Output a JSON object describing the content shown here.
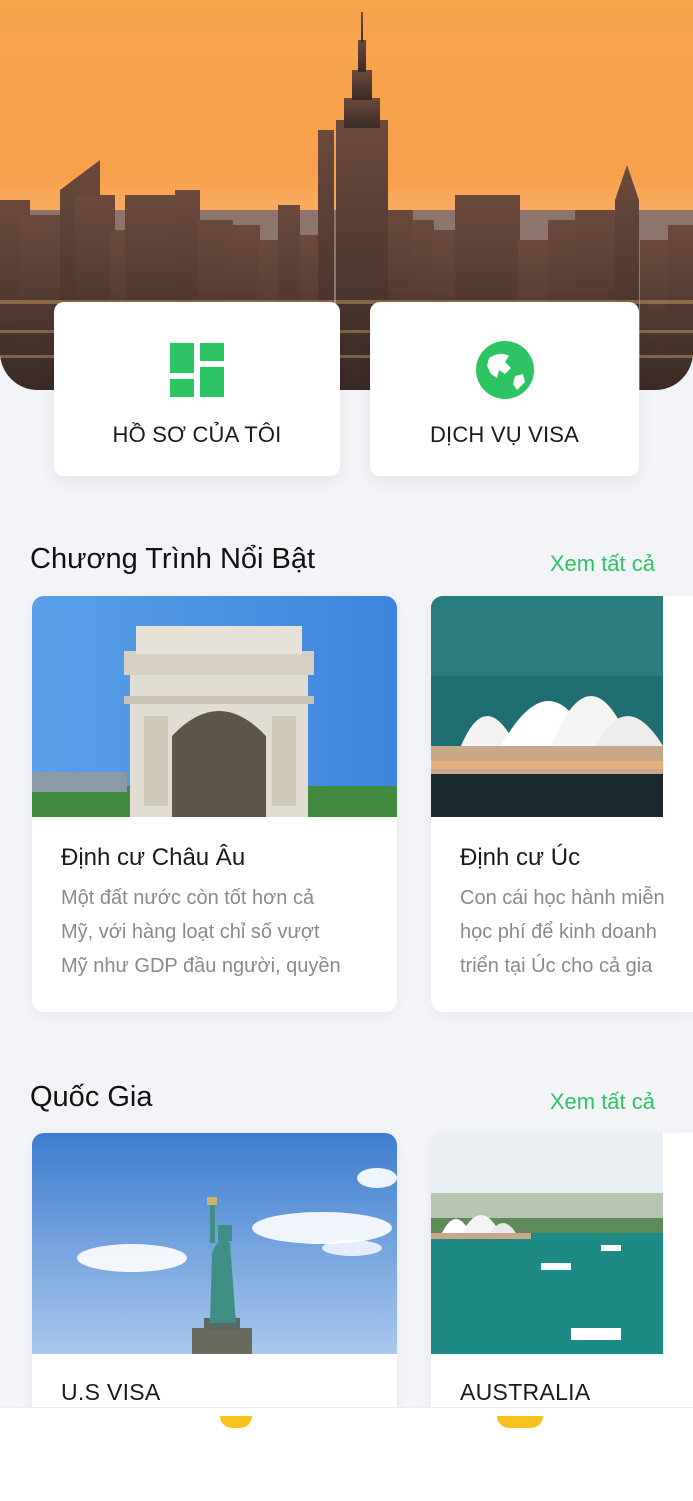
{
  "quick_actions": [
    {
      "label": "HỒ SƠ CỦA TÔI",
      "icon": "dashboard-grid-icon"
    },
    {
      "label": "DỊCH VỤ VISA",
      "icon": "globe-icon"
    }
  ],
  "featured": {
    "title": "Chương Trình Nổi Bật",
    "see_all": "Xem tất cả",
    "items": [
      {
        "title": "Định cư Châu Âu",
        "desc_lines": [
          "Một đất nước còn tốt hơn cả",
          "Mỹ, với hàng loạt chỉ số vượt",
          "Mỹ như GDP đầu người, quyền"
        ],
        "image": "arc-de-triomphe-photo"
      },
      {
        "title": "Định cư Úc",
        "desc_lines": [
          "Con cái học hành miễn",
          "học phí để kinh doanh",
          "triển tại Úc cho cả gia"
        ],
        "image": "sydney-opera-house-photo"
      }
    ]
  },
  "countries": {
    "title": "Quốc Gia",
    "see_all": "Xem tất cả",
    "items": [
      {
        "title": "U.S VISA",
        "image": "statue-of-liberty-photo"
      },
      {
        "title": "AUSTRALIA",
        "image": "sydney-harbour-photo"
      }
    ]
  },
  "colors": {
    "accent_green": "#2dc564",
    "page_bg": "#f3f4f8",
    "tab_indicator": "#f6c21f"
  },
  "hero_image": "new-york-skyline-sunset-photo"
}
